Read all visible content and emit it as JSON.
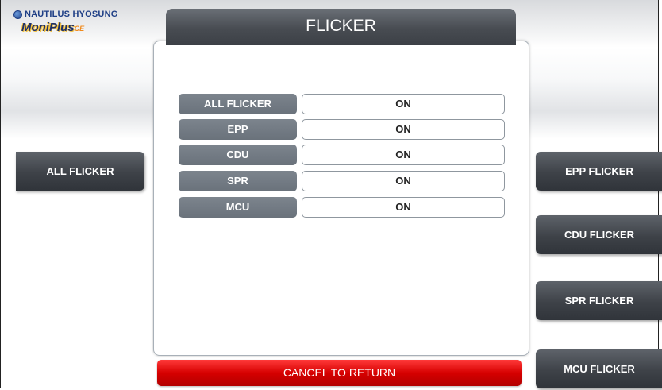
{
  "brand": {
    "company": "NAUTILUS HYOSUNG",
    "product": "MoniPlus",
    "product_suffix": "CE",
    "logo_icon": "globe-icon"
  },
  "screen": {
    "title": "FLICKER"
  },
  "status_rows": [
    {
      "label": "ALL FLICKER",
      "value": "ON"
    },
    {
      "label": "EPP",
      "value": "ON"
    },
    {
      "label": "CDU",
      "value": "ON"
    },
    {
      "label": "SPR",
      "value": "ON"
    },
    {
      "label": "MCU",
      "value": "ON"
    }
  ],
  "left_buttons": [
    {
      "label": "ALL FLICKER"
    }
  ],
  "right_buttons": [
    {
      "label": "EPP FLICKER"
    },
    {
      "label": "CDU FLICKER"
    },
    {
      "label": "SPR FLICKER"
    },
    {
      "label": "MCU FLICKER"
    }
  ],
  "cancel": {
    "label": "CANCEL TO RETURN"
  },
  "colors": {
    "accent_red": "#d60000",
    "button_dark": "#3e4248",
    "label_gray": "#6a727b",
    "brand_blue": "#1f3f86"
  }
}
